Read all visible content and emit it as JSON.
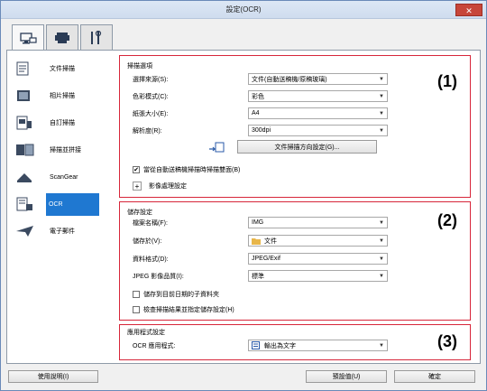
{
  "window": {
    "title": "設定(OCR)",
    "close_glyph": "✕"
  },
  "tabs": [
    {
      "icon": "scanner-computer-icon"
    },
    {
      "icon": "scanner-icon"
    },
    {
      "icon": "tools-icon"
    }
  ],
  "sidebar": {
    "items": [
      {
        "label": "文件掃描",
        "icon": "document-scan-icon"
      },
      {
        "label": "相片掃描",
        "icon": "photo-scan-icon"
      },
      {
        "label": "自訂掃描",
        "icon": "custom-scan-icon"
      },
      {
        "label": "掃描並拼接",
        "icon": "stitch-scan-icon"
      },
      {
        "label": "ScanGear",
        "icon": "scangear-icon"
      },
      {
        "label": "OCR",
        "icon": "ocr-icon"
      },
      {
        "label": "電子郵件",
        "icon": "email-icon"
      }
    ],
    "selected_index": 5
  },
  "scan_options": {
    "title": "掃描選項",
    "number": "(1)",
    "select_source": {
      "label": "選擇來源(S):",
      "value": "文件(自動送稿機/原稿玻璃)"
    },
    "color_mode": {
      "label": "色彩模式(C):",
      "value": "彩色"
    },
    "paper_size": {
      "label": "紙張大小(E):",
      "value": "A4"
    },
    "resolution": {
      "label": "解析度(R):",
      "value": "300dpi"
    },
    "orientation_button": "文件掃描方向設定(G)...",
    "duplex_checkbox": {
      "label": "當從自動送稿機掃描時掃描雙面(B)",
      "checked": true
    },
    "image_processing": "影像處理設定"
  },
  "save_settings": {
    "title": "儲存設定",
    "number": "(2)",
    "file_name": {
      "label": "檔案名稱(F):",
      "value": "IMG"
    },
    "save_in": {
      "label": "儲存於(V):",
      "value": "文件"
    },
    "data_format": {
      "label": "資料格式(D):",
      "value": "JPEG/Exif"
    },
    "jpeg_quality": {
      "label": "JPEG 影像品質(I):",
      "value": "標準"
    },
    "subfolder_checkbox": {
      "label": "儲存到目前日期的子資料夾",
      "checked": false
    },
    "check_results_checkbox": {
      "label": "檢查掃描結果並指定儲存設定(H)",
      "checked": false
    }
  },
  "app_settings": {
    "title": "應用程式設定",
    "number": "(3)",
    "ocr_app": {
      "label": "OCR 應用程式:",
      "value": "輸出為文字"
    }
  },
  "footer": {
    "help_button": "使用說明(I)",
    "defaults_button": "預設值(U)",
    "ok_button": "確定"
  },
  "colors": {
    "accent_red": "#d7263a",
    "selection_blue": "#1f78d1"
  }
}
